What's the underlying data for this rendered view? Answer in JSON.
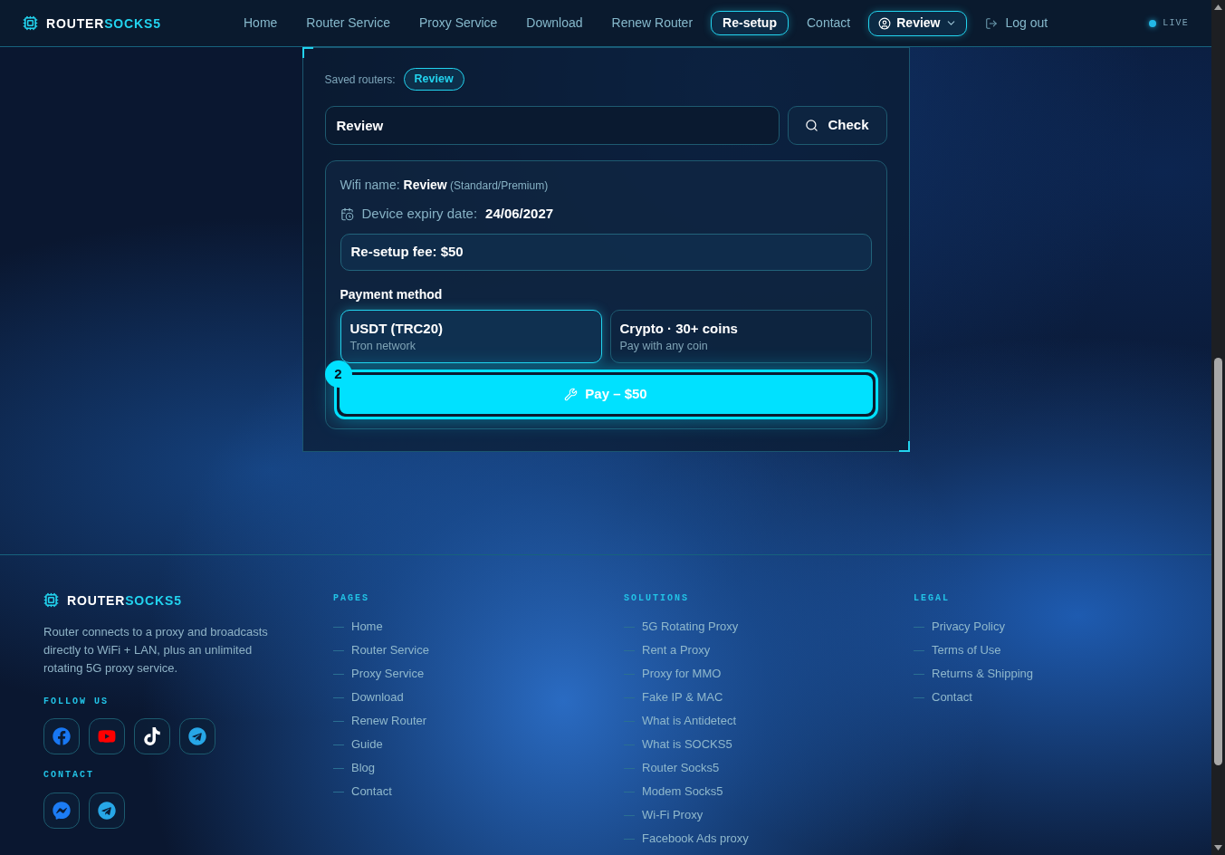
{
  "header": {
    "logo": {
      "primary": "ROUTER",
      "accent": "SOCKS5"
    },
    "nav": [
      {
        "label": "Home",
        "selected": false
      },
      {
        "label": "Router Service",
        "selected": false
      },
      {
        "label": "Proxy Service",
        "selected": false
      },
      {
        "label": "Download",
        "selected": false
      },
      {
        "label": "Renew Router",
        "selected": false
      },
      {
        "label": "Re-setup",
        "selected": true
      },
      {
        "label": "Contact",
        "selected": false
      }
    ],
    "user_menu": {
      "label": "Review"
    },
    "logout": {
      "label": "Log out"
    },
    "status": {
      "label": "LIVE"
    }
  },
  "check_form": {
    "saved_routers": {
      "label": "Saved routers:",
      "chips": [
        {
          "label": "Review"
        }
      ]
    },
    "search": {
      "value": "Review",
      "button": "Check"
    },
    "result": {
      "wifi_label": "Wifi name:",
      "wifi_name": "Review",
      "wifi_plan": "(Standard/Premium)",
      "expiry_label": "Device expiry date:",
      "expiry_date": "24/06/2027",
      "fee": "Re-setup fee: $50",
      "payment": {
        "heading": "Payment method",
        "options": [
          {
            "title": "USDT (TRC20)",
            "subtitle": "Tron network",
            "selected": true
          },
          {
            "title": "Crypto · 30+ coins",
            "subtitle": "Pay with any coin",
            "selected": false
          }
        ]
      },
      "step": "2",
      "pay_button": "Pay – $50"
    }
  },
  "footer": {
    "brand": {
      "logo": {
        "primary": "ROUTER",
        "accent": "SOCKS5"
      },
      "description": "Router connects to a proxy and broadcasts directly to WiFi + LAN, plus an unlimited rotating 5G proxy service.",
      "follow": {
        "heading": "FOLLOW US",
        "links": [
          {
            "kind": "facebook"
          },
          {
            "kind": "youtube"
          },
          {
            "kind": "tiktok"
          },
          {
            "kind": "telegram"
          }
        ]
      },
      "contact": {
        "heading": "CONTACT",
        "links": [
          {
            "kind": "messenger"
          },
          {
            "kind": "telegram"
          }
        ]
      }
    },
    "columns": [
      {
        "heading": "PAGES",
        "links": [
          "Home",
          "Router Service",
          "Proxy Service",
          "Download",
          "Renew Router",
          "Guide",
          "Blog",
          "Contact"
        ]
      },
      {
        "heading": "SOLUTIONS",
        "links": [
          "5G Rotating Proxy",
          "Rent a Proxy",
          "Proxy for MMO",
          "Fake IP & MAC",
          "What is Antidetect",
          "What is SOCKS5",
          "Router Socks5",
          "Modem Socks5",
          "Wi-Fi Proxy",
          "Facebook Ads proxy"
        ]
      },
      {
        "heading": "LEGAL",
        "links": [
          "Privacy Policy",
          "Terms of Use",
          "Returns & Shipping",
          "Contact"
        ]
      }
    ]
  }
}
